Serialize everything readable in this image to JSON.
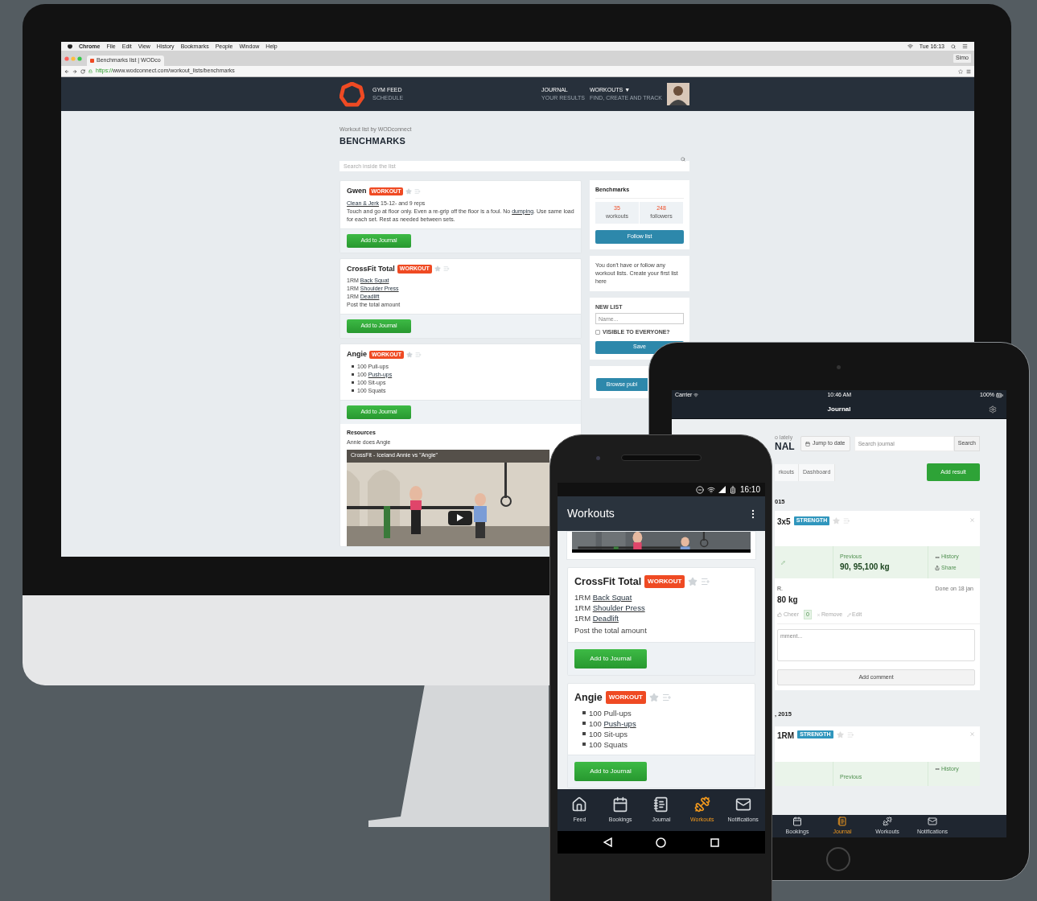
{
  "desktop": {
    "menu_bar": {
      "items": [
        "Chrome",
        "File",
        "Edit",
        "View",
        "History",
        "Bookmarks",
        "People",
        "Window",
        "Help"
      ],
      "clock": "Tue 16:13"
    },
    "tab": {
      "title": "Benchmarks list | WODco"
    },
    "profile": "Simo",
    "url": {
      "scheme": "https://",
      "rest": "www.wodconnect.com/workout_lists/benchmarks"
    },
    "site_nav": [
      {
        "label": "GYM FEED",
        "sub": "SCHEDULE"
      },
      {
        "label": "JOURNAL",
        "sub": "YOUR RESULTS"
      },
      {
        "label": "WORKOUTS ▼",
        "sub": "FIND, CREATE AND TRACK"
      }
    ],
    "subtitle": "Workout list by WODconnect",
    "title": "BENCHMARKS",
    "search": {
      "placeholder": "Search inside the list"
    },
    "workouts": [
      {
        "name": "Gwen",
        "badge": "WORKOUT",
        "lines": [
          {
            "kind": "text",
            "parts": [
              {
                "text": "Clean & Jerk",
                "link": true
              },
              {
                "text": " 15-12- and 9 reps",
                "link": false
              }
            ]
          },
          {
            "kind": "text",
            "parts": [
              {
                "text": "Touch and go at floor only. Even a re-grip off the floor is a foul. No ",
                "link": false
              },
              {
                "text": "dumping",
                "link": true
              },
              {
                "text": ". Use same load for each set. Rest as needed between sets.",
                "link": false
              }
            ]
          }
        ],
        "button": "Add to Journal"
      },
      {
        "name": "CrossFit Total",
        "badge": "WORKOUT",
        "lines": [
          {
            "kind": "tight",
            "parts": [
              {
                "text": "1RM ",
                "link": false
              },
              {
                "text": "Back Squat",
                "link": true
              }
            ]
          },
          {
            "kind": "tight",
            "parts": [
              {
                "text": "1RM ",
                "link": false
              },
              {
                "text": "Shoulder Press",
                "link": true
              }
            ]
          },
          {
            "kind": "tight",
            "parts": [
              {
                "text": "1RM ",
                "link": false
              },
              {
                "text": "Deadlift",
                "link": true
              }
            ]
          },
          {
            "kind": "text",
            "parts": [
              {
                "text": "Post the total amount",
                "link": false
              }
            ]
          }
        ],
        "button": "Add to Journal"
      },
      {
        "name": "Angie",
        "badge": "WORKOUT",
        "lines": [
          {
            "kind": "bullet",
            "parts": [
              {
                "text": "100 Pull-ups",
                "link": false
              }
            ]
          },
          {
            "kind": "bullet",
            "parts": [
              {
                "text": "100 ",
                "link": false
              },
              {
                "text": "Push-ups",
                "link": true
              }
            ]
          },
          {
            "kind": "bullet",
            "parts": [
              {
                "text": "100 Sit-ups",
                "link": false
              }
            ]
          },
          {
            "kind": "bullet",
            "parts": [
              {
                "text": "100 Squats",
                "link": false
              }
            ]
          }
        ],
        "button": "Add to Journal"
      }
    ],
    "resources": {
      "title": "Resources",
      "caption": "Annie does Angie",
      "video_title": "CrossFit - Iceland Annie vs \"Angie\""
    },
    "sidebar": {
      "title": "Benchmarks",
      "stats": [
        {
          "value": "35",
          "label": "workouts"
        },
        {
          "value": "248",
          "label": "followers"
        }
      ],
      "follow_button": "Follow list",
      "empty_note": "You don't have or follow any workout lists. Create your first list here",
      "new_list": {
        "label": "NEW LIST",
        "placeholder": "Name...",
        "visible_label": "VISIBLE TO EVERYONE?",
        "visible_checked": false,
        "save": "Save"
      },
      "browse_button": "Browse publ"
    }
  },
  "tablet": {
    "status": {
      "carrier": "Carrier",
      "time": "10:46 AM",
      "battery": "100%"
    },
    "title": "Journal",
    "subtitle": "o lately",
    "heading": "NAL",
    "jump_button": "Jump to date",
    "search": {
      "placeholder": "Search journal",
      "button": "Search"
    },
    "tabs": [
      {
        "label": "rkouts",
        "selected": false
      },
      {
        "label": "Dashboard",
        "selected": false
      }
    ],
    "add_button": "Add result",
    "entries": [
      {
        "date": "015",
        "name": "3x5",
        "badge": "STRENGTH",
        "previous_label": "Previous",
        "previous": "90, 95,100 kg",
        "history": "History",
        "share": "Share",
        "athlete": "R.",
        "done": "Done on 18 jan",
        "result": "80 kg",
        "cheer": "Cheer",
        "cheer_count": "0",
        "remove": "Remove",
        "edit": "Edit",
        "comment_placeholder": "mment...",
        "comment_button": "Add comment"
      },
      {
        "date": ", 2015",
        "name": "1RM",
        "badge": "STRENGTH",
        "previous_label": "Previous",
        "history": "History"
      }
    ],
    "nav": [
      {
        "kind": "bookings",
        "label": "Bookings",
        "selected": false
      },
      {
        "kind": "journal",
        "label": "Journal",
        "selected": true
      },
      {
        "kind": "workouts",
        "label": "Workouts",
        "selected": false
      },
      {
        "kind": "notifications",
        "label": "Notifications",
        "selected": false
      }
    ]
  },
  "phone": {
    "status_time": "16:10",
    "title": "Workouts",
    "workouts": [
      {
        "name": "CrossFit Total",
        "badge": "WORKOUT",
        "lines": [
          {
            "kind": "tight",
            "parts": [
              {
                "text": "1RM ",
                "link": false
              },
              {
                "text": "Back Squat",
                "link": true
              }
            ]
          },
          {
            "kind": "tight",
            "parts": [
              {
                "text": "1RM ",
                "link": false
              },
              {
                "text": "Shoulder Press",
                "link": true
              }
            ]
          },
          {
            "kind": "tight",
            "parts": [
              {
                "text": "1RM ",
                "link": false
              },
              {
                "text": "Deadlift",
                "link": true
              }
            ]
          },
          {
            "kind": "text",
            "parts": [
              {
                "text": "Post the total amount",
                "link": false
              }
            ]
          }
        ],
        "button": "Add to Journal"
      },
      {
        "name": "Angie",
        "badge": "WORKOUT",
        "lines": [
          {
            "kind": "bullet",
            "parts": [
              {
                "text": "100 Pull-ups",
                "link": false
              }
            ]
          },
          {
            "kind": "bullet",
            "parts": [
              {
                "text": "100 ",
                "link": false
              },
              {
                "text": "Push-ups",
                "link": true
              }
            ]
          },
          {
            "kind": "bullet",
            "parts": [
              {
                "text": "100 Sit-ups",
                "link": false
              }
            ]
          },
          {
            "kind": "bullet",
            "parts": [
              {
                "text": "100 Squats",
                "link": false
              }
            ]
          }
        ],
        "button": "Add to Journal"
      }
    ],
    "nav": [
      {
        "kind": "feed",
        "label": "Feed",
        "selected": false
      },
      {
        "kind": "bookings",
        "label": "Bookings",
        "selected": false
      },
      {
        "kind": "journal",
        "label": "Journal",
        "selected": false
      },
      {
        "kind": "workouts",
        "label": "Workouts",
        "selected": true
      },
      {
        "kind": "notifications",
        "label": "Notifications",
        "selected": false
      }
    ]
  }
}
